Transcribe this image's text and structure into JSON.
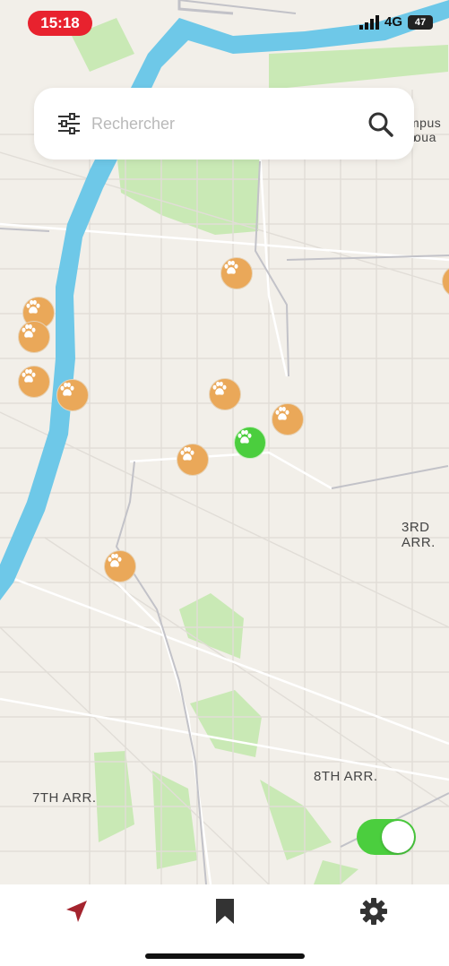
{
  "status": {
    "time": "15:18",
    "network": "4G",
    "battery": "47"
  },
  "search": {
    "placeholder": "Rechercher"
  },
  "map": {
    "labels": [
      "3RD ARR.",
      "8TH ARR.",
      "7TH ARR.",
      "mpus h",
      "oua"
    ]
  },
  "colors": {
    "pin": "#eaa859",
    "pin_active": "#4bce3e",
    "tab_active": "#a4242e",
    "river": "#6ec8e8",
    "park": "#c9e9b5"
  },
  "tabbar": {
    "items": [
      "location-arrow-icon",
      "bookmark-icon",
      "gear-icon"
    ]
  },
  "toggle": {
    "on": true
  }
}
